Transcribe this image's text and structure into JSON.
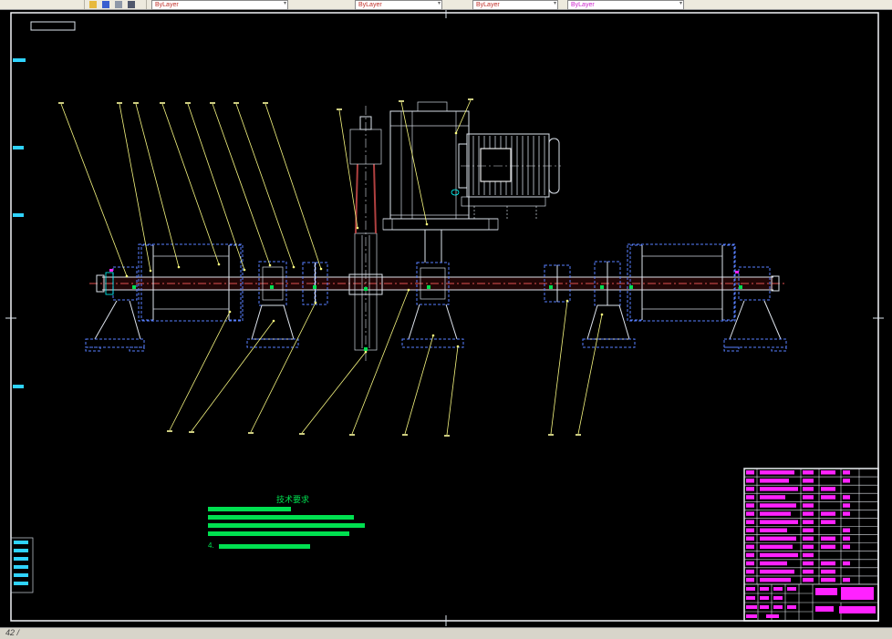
{
  "toolbar": {
    "color_combo": {
      "value": "ByLayer"
    },
    "linetype_combo": {
      "value": "ByLayer"
    },
    "lineweight_combo": {
      "value": "ByLayer"
    },
    "plotstyle_combo": {
      "value": "ByLayer"
    }
  },
  "drawing": {
    "tech_notes": {
      "title": "技术要求",
      "item_prefix": "4.",
      "bars": [
        91,
        160,
        172,
        155,
        100
      ]
    },
    "title_block": {
      "bom_rows": [
        [
          9,
          38,
          12,
          16,
          8
        ],
        [
          9,
          32,
          12,
          0,
          8
        ],
        [
          9,
          42,
          12,
          16,
          0
        ],
        [
          9,
          28,
          12,
          16,
          8
        ],
        [
          9,
          40,
          12,
          0,
          8
        ],
        [
          9,
          34,
          12,
          16,
          8
        ],
        [
          9,
          42,
          12,
          16,
          0
        ],
        [
          9,
          30,
          12,
          0,
          8
        ],
        [
          9,
          40,
          12,
          16,
          8
        ],
        [
          9,
          36,
          12,
          16,
          8
        ],
        [
          9,
          42,
          12,
          0,
          0
        ],
        [
          9,
          30,
          12,
          16,
          8
        ],
        [
          9,
          38,
          12,
          16,
          0
        ],
        [
          9,
          34,
          12,
          16,
          8
        ]
      ],
      "detail_bars": [
        [
          818,
          644,
          10,
          4
        ],
        [
          833,
          644,
          10,
          4
        ],
        [
          848,
          644,
          10,
          4
        ],
        [
          863,
          644,
          10,
          4
        ],
        [
          818,
          654,
          10,
          4
        ],
        [
          833,
          654,
          10,
          4
        ],
        [
          848,
          654,
          10,
          4
        ],
        [
          818,
          664,
          12,
          4
        ],
        [
          833,
          664,
          10,
          4
        ],
        [
          848,
          664,
          10,
          4
        ],
        [
          863,
          664,
          10,
          4
        ],
        [
          818,
          674,
          12,
          4
        ],
        [
          840,
          674,
          14,
          4
        ],
        [
          894,
          645,
          24,
          8
        ],
        [
          922,
          644,
          36,
          14
        ],
        [
          894,
          665,
          20,
          6
        ],
        [
          920,
          665,
          40,
          8
        ]
      ]
    },
    "colors": {
      "background": "#000000",
      "frame": "#ffffff",
      "hidden_blue": "#577fff",
      "leader_yellow": "#f7f780",
      "notes_green": "#00e050",
      "titleblock_magenta": "#ff22ff",
      "centerline_red": "#e05050",
      "marker_cyan": "#2fd3ff"
    }
  },
  "status": {
    "left": "42 /"
  }
}
